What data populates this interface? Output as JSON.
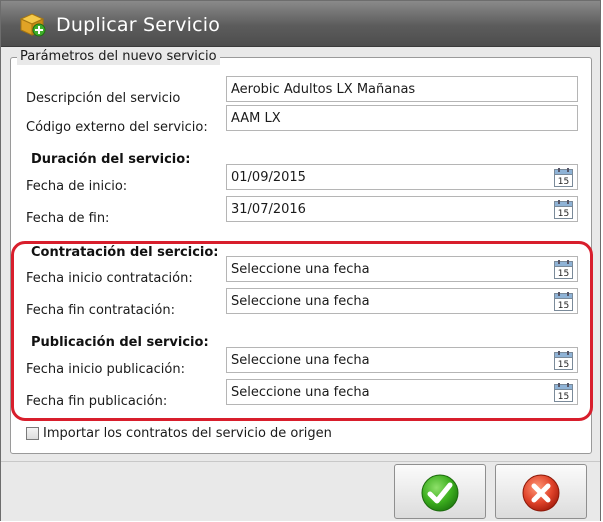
{
  "window": {
    "title": "Duplicar Servicio",
    "icon": "box-add-icon"
  },
  "group": {
    "legend": "Parámetros del nuevo servicio"
  },
  "fields": {
    "descripcion": {
      "label": "Descripción del servicio",
      "value": "Aerobic Adultos LX Mañanas"
    },
    "codigo": {
      "label": "Código externo del servicio:",
      "value": "AAM LX"
    }
  },
  "duracion": {
    "title": "Duración del servicio:",
    "inicio": {
      "label": "Fecha de inicio:",
      "value": "01/09/2015"
    },
    "fin": {
      "label": "Fecha de fin:",
      "value": "31/07/2016"
    }
  },
  "contratacion": {
    "title": "Contratación del sercicio:",
    "inicio": {
      "label": "Fecha inicio contratación:",
      "placeholder": "Seleccione una fecha"
    },
    "fin": {
      "label": "Fecha fin contratación:",
      "placeholder": "Seleccione una fecha"
    }
  },
  "publicacion": {
    "title": "Publicación del servicio:",
    "inicio": {
      "label": "Fecha inicio publicación:",
      "placeholder": "Seleccione una fecha"
    },
    "fin": {
      "label": "Fecha fin publicación:",
      "placeholder": "Seleccione una fecha"
    }
  },
  "calendar_day": "15",
  "importar": {
    "label": "Importar los contratos del servicio de origen",
    "checked": false
  },
  "buttons": {
    "ok_icon": "check-icon",
    "cancel_icon": "cancel-x-icon"
  },
  "colors": {
    "highlight": "#d81e2c",
    "ok": "#3cae1e",
    "cancel": "#e0432a"
  }
}
